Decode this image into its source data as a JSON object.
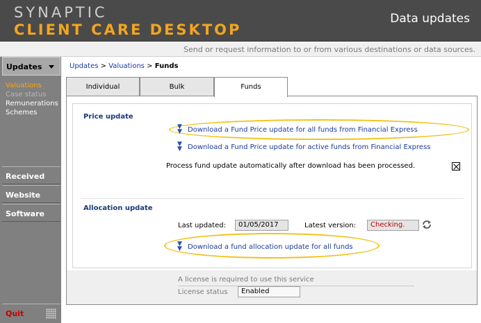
{
  "header": {
    "brand_line1": "SYNAPTIC",
    "brand_line2": "CLIENT CARE DESKTOP",
    "title": "Data updates",
    "brand_color": "#f2a51f"
  },
  "subheader": {
    "text": "Send or request information to or from various destinations or data sources."
  },
  "sidebar": {
    "updates_label": "Updates",
    "items": [
      {
        "label": "Valuations",
        "state": "active"
      },
      {
        "label": "Case status",
        "state": "disabled"
      },
      {
        "label": "Remunerations",
        "state": "normal"
      },
      {
        "label": "Schemes",
        "state": "normal"
      }
    ],
    "received_label": "Received",
    "website_label": "Website",
    "software_label": "Software",
    "quit_label": "Quit"
  },
  "breadcrumb": {
    "part1": "Updates",
    "sep1": " > ",
    "part2": "Valuations",
    "sep2": " > ",
    "current": "Funds"
  },
  "tabs": [
    {
      "label": "Individual"
    },
    {
      "label": "Bulk"
    },
    {
      "label": "Funds",
      "selected": true
    }
  ],
  "price_update": {
    "title": "Price update",
    "link_all": "Download a Fund Price update for all funds from Financial Express",
    "link_active": "Download a Fund Price update for active funds from Financial Express",
    "auto_process_label": "Process fund update automatically after download has been processed.",
    "auto_process_checked": true
  },
  "allocation_update": {
    "title": "Allocation update",
    "last_updated_label": "Last updated:",
    "last_updated_value": "01/05/2017",
    "latest_version_label": "Latest version:",
    "latest_version_value": "Checking.",
    "link_all": "Download a fund allocation update for all funds"
  },
  "license": {
    "note": "A license is required to use this service",
    "status_label": "License status",
    "status_value": "Enabled"
  },
  "icons": {
    "download": "download-arrow-icon",
    "refresh": "refresh-icon",
    "grip": "resize-grip-icon"
  }
}
